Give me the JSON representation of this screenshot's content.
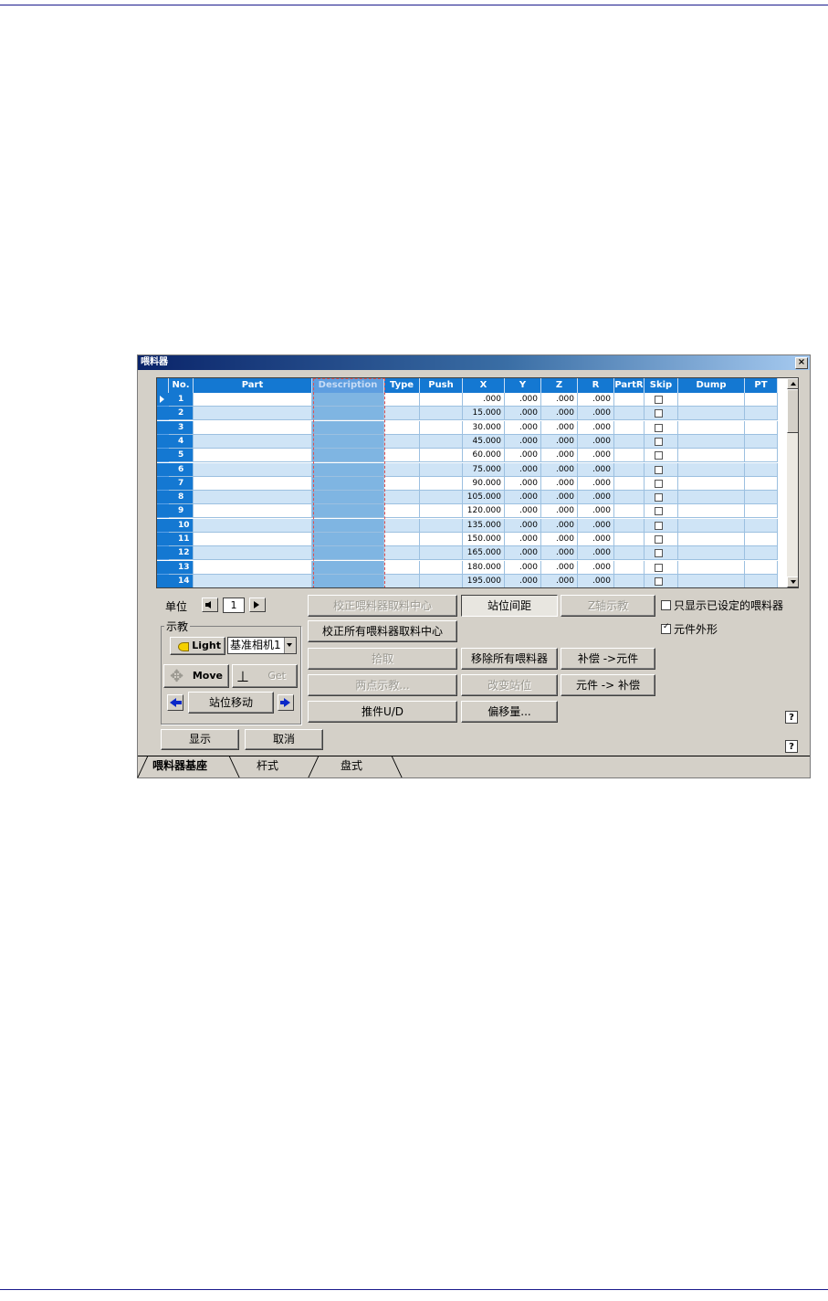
{
  "window": {
    "title": "喂料器",
    "close": "×"
  },
  "grid": {
    "columns": [
      "No.",
      "Part",
      "Description",
      "Type",
      "Push",
      "X",
      "Y",
      "Z",
      "R",
      "PartR",
      "Skip",
      "Dump",
      "PT"
    ],
    "rows": [
      {
        "no": "1",
        "x": ".000",
        "y": ".000",
        "z": ".000",
        "r": ".000"
      },
      {
        "no": "2",
        "x": "15.000",
        "y": ".000",
        "z": ".000",
        "r": ".000"
      },
      {
        "no": "3",
        "x": "30.000",
        "y": ".000",
        "z": ".000",
        "r": ".000"
      },
      {
        "no": "4",
        "x": "45.000",
        "y": ".000",
        "z": ".000",
        "r": ".000"
      },
      {
        "no": "5",
        "x": "60.000",
        "y": ".000",
        "z": ".000",
        "r": ".000"
      },
      {
        "no": "6",
        "x": "75.000",
        "y": ".000",
        "z": ".000",
        "r": ".000"
      },
      {
        "no": "7",
        "x": "90.000",
        "y": ".000",
        "z": ".000",
        "r": ".000"
      },
      {
        "no": "8",
        "x": "105.000",
        "y": ".000",
        "z": ".000",
        "r": ".000"
      },
      {
        "no": "9",
        "x": "120.000",
        "y": ".000",
        "z": ".000",
        "r": ".000"
      },
      {
        "no": "10",
        "x": "135.000",
        "y": ".000",
        "z": ".000",
        "r": ".000"
      },
      {
        "no": "11",
        "x": "150.000",
        "y": ".000",
        "z": ".000",
        "r": ".000"
      },
      {
        "no": "12",
        "x": "165.000",
        "y": ".000",
        "z": ".000",
        "r": ".000"
      },
      {
        "no": "13",
        "x": "180.000",
        "y": ".000",
        "z": ".000",
        "r": ".000"
      },
      {
        "no": "14",
        "x": "195.000",
        "y": ".000",
        "z": ".000",
        "r": ".000"
      }
    ]
  },
  "unit": {
    "label": "单位",
    "value": "1"
  },
  "teach": {
    "group_label": "示教",
    "light_label": "Light",
    "camera_value": "基准相机1",
    "move_label": "Move",
    "get_label": "Get",
    "station_move_label": "站位移动"
  },
  "buttons": {
    "calibrate_center": "校正喂料器取料中心",
    "station_pitch": "站位间距",
    "z_teach": "Z轴示教",
    "calibrate_all": "校正所有喂料器取料中心",
    "pick": "拾取",
    "remove_all": "移除所有喂料器",
    "comp_to_part": "补偿 ->元件",
    "two_point_teach": "两点示教...",
    "change_station": "改变站位",
    "part_to_comp": "元件 -> 补偿",
    "pusher_ud": "推件U/D",
    "offset": "偏移量...",
    "show": "显示",
    "cancel": "取消",
    "help": "?"
  },
  "options": {
    "show_defined_only": "只显示已设定的喂料器",
    "show_defined_only_checked": false,
    "part_outline": "元件外形",
    "part_outline_checked": true
  },
  "tabs": [
    "喂料器基座",
    "杆式",
    "盘式"
  ],
  "colors": {
    "header": "#1478d2",
    "row_alt": "#cfe4f6",
    "highlight": "#e05050"
  }
}
